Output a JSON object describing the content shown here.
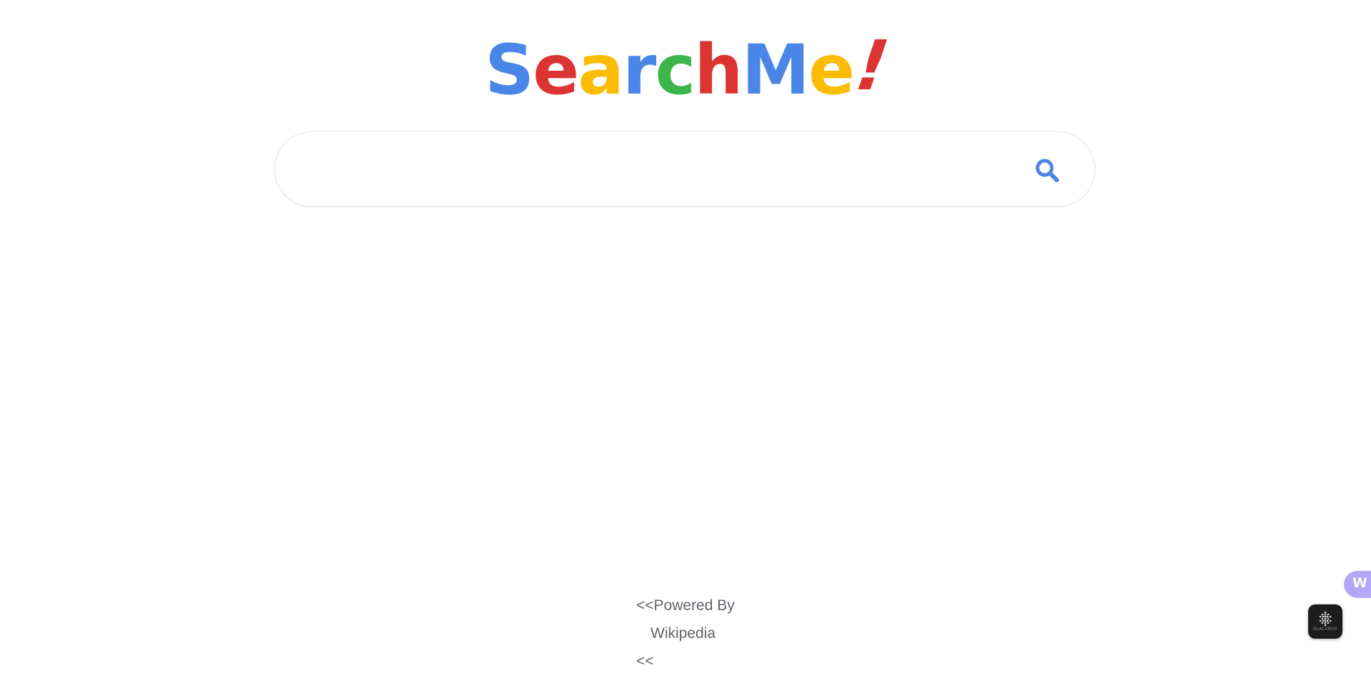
{
  "logo": {
    "letters": [
      {
        "char": "S",
        "color": "#4a86e8"
      },
      {
        "char": "e",
        "color": "#dc3433"
      },
      {
        "char": "a",
        "color": "#fbbc05"
      },
      {
        "char": "r",
        "color": "#4a86e8"
      },
      {
        "char": "c",
        "color": "#3cb54a"
      },
      {
        "char": "h",
        "color": "#dc3433"
      },
      {
        "char": "M",
        "color": "#4a86e8"
      },
      {
        "char": "e",
        "color": "#fbbc05"
      },
      {
        "char": "!",
        "color": "#dc3433"
      }
    ]
  },
  "search": {
    "value": "",
    "placeholder": "",
    "icon": "search-icon",
    "icon_color": "#4a86e8"
  },
  "footer": {
    "line1": "<<Powered By",
    "line2": "Wikipedia",
    "line3": "<<"
  },
  "side_tab": {
    "label": "W",
    "color": "#b4a7f5"
  },
  "widget": {
    "label": "BLACKBOX",
    "icon": "dot-grid-icon"
  }
}
